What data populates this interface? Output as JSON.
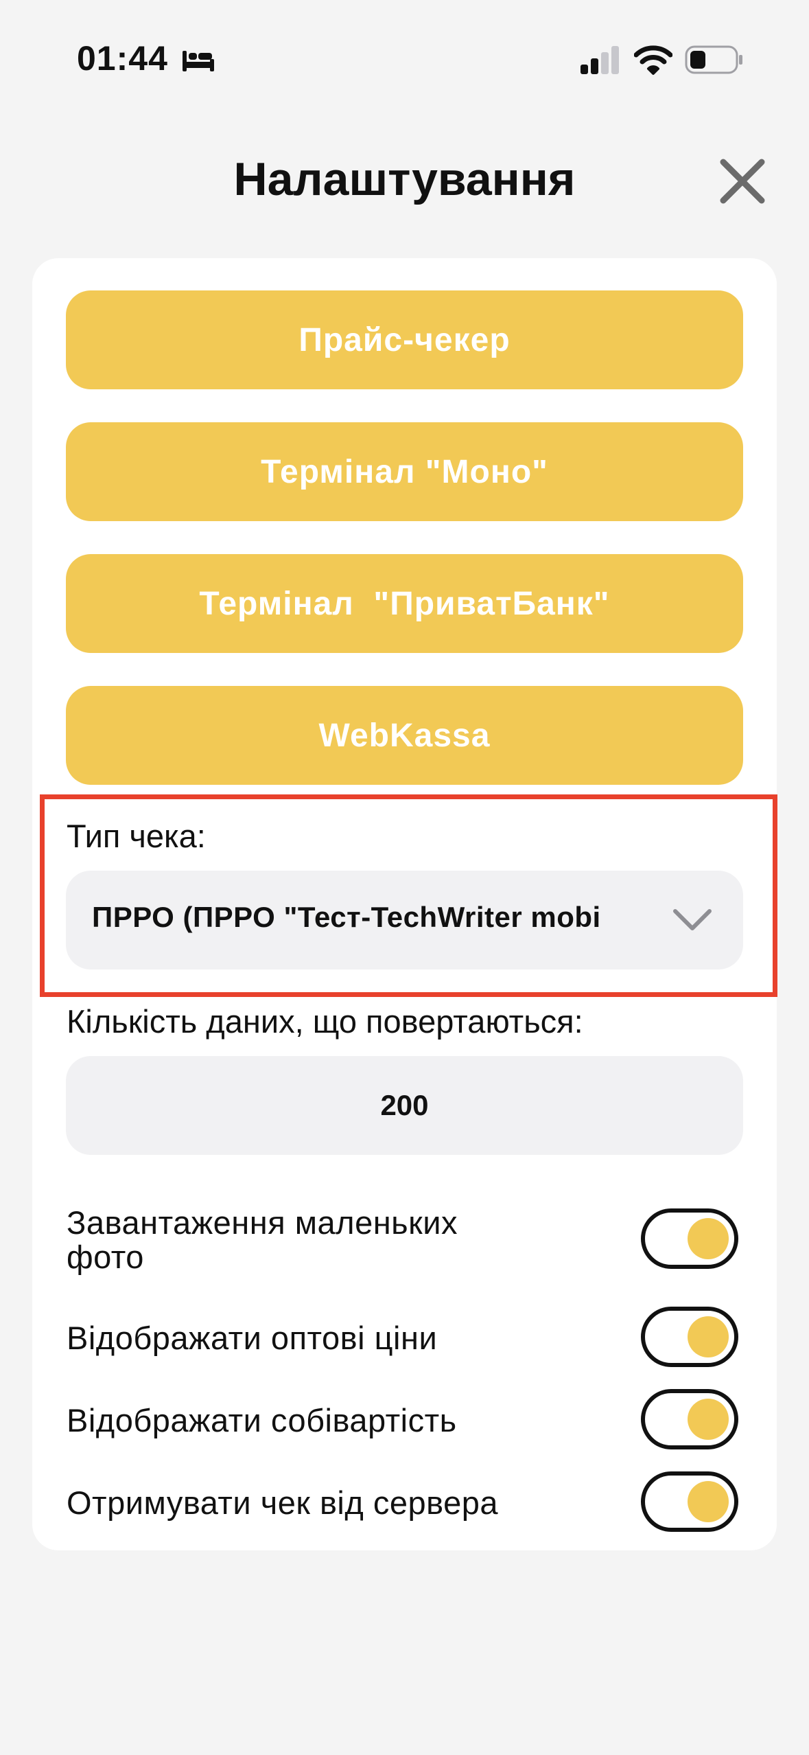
{
  "status_bar": {
    "time": "01:44"
  },
  "header": {
    "title": "Налаштування"
  },
  "menu_buttons": [
    {
      "label": "Прайс-чекер"
    },
    {
      "label": "Термінал \"Моно\""
    },
    {
      "label": "Термінал  \"ПриватБанк\""
    },
    {
      "label": "WebKassa"
    }
  ],
  "receipt_type": {
    "label": "Тип чека:",
    "value": "ПРРО (ПРРО \"Тест-TechWriter mobi"
  },
  "data_count": {
    "label": "Кількість даних, що повертаються:",
    "value": "200"
  },
  "toggles": [
    {
      "label_line1": "Завантаження маленьких",
      "label_line2": "фото",
      "on": true
    },
    {
      "label": "Відображати оптові ціни",
      "on": true
    },
    {
      "label": "Відображати собівартість",
      "on": true
    },
    {
      "label": "Отримувати чек від сервера",
      "on": true
    }
  ],
  "colors": {
    "accent": "#f2c955",
    "highlight": "#e8412c",
    "field_bg": "#f1f1f3",
    "page_bg": "#f4f4f4"
  }
}
